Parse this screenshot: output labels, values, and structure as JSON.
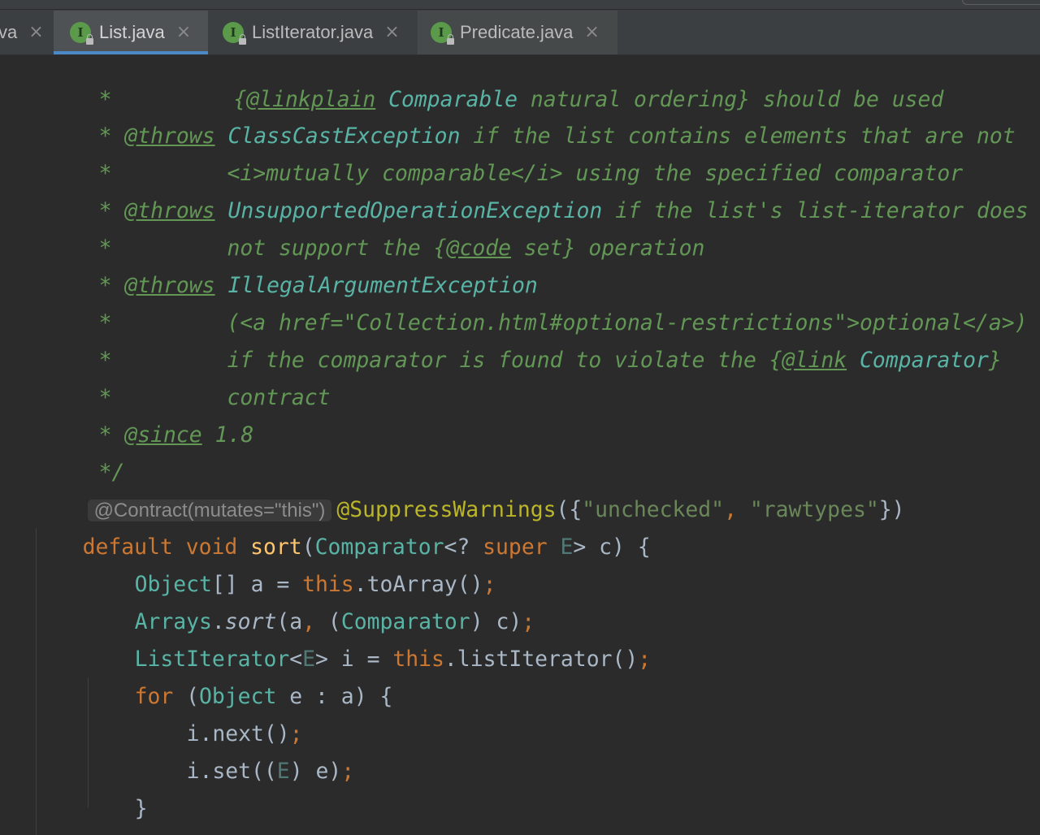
{
  "tabs": [
    {
      "label": "va",
      "active": false
    },
    {
      "label": "List.java",
      "active": true,
      "icon": "interface-icon"
    },
    {
      "label": "ListIterator.java",
      "active": false,
      "icon": "interface-icon"
    },
    {
      "label": "Predicate.java",
      "active": false,
      "icon": "interface-icon"
    }
  ],
  "tab_close_glyph": "×",
  "icon_letter": "I",
  "code": {
    "l1": {
      "star": "*",
      "open": "{",
      "tag": "@linkplain",
      "ref": "Comparable",
      "rest": " natural ordering} should be used"
    },
    "l2": {
      "star": "*",
      "tag": "@throws",
      "ref": "ClassCastException",
      "rest": " if the list contains elements that are not"
    },
    "l3": {
      "star": "*",
      "rest": "<i>mutually comparable</i> using the specified comparator"
    },
    "l4": {
      "star": "*",
      "tag": "@throws",
      "ref": "UnsupportedOperationException",
      "rest": " if the list's list-iterator does"
    },
    "l5": {
      "star": "*",
      "pre": "not support the {",
      "tag": "@code",
      "rest": " set} operation"
    },
    "l6": {
      "star": "*",
      "tag": "@throws",
      "ref": "IllegalArgumentException"
    },
    "l7": {
      "star": "*",
      "rest": "(<a href=\"Collection.html#optional-restrictions\">optional</a>)"
    },
    "l8": {
      "star": "*",
      "pre": "if the comparator is found to violate the {",
      "tag": "@link",
      "ref": "Comparator",
      "rest": "}"
    },
    "l9": {
      "star": "*",
      "rest": "contract"
    },
    "l10": {
      "star": "*",
      "tag": "@since",
      "rest": " 1.8"
    },
    "l11": {
      "end": "*/"
    },
    "l12": {
      "inlay": "@Contract(mutates=\"this\")",
      "ann": "@SuppressWarnings",
      "p1": "({",
      "s1": "\"unchecked\"",
      "comma": ", ",
      "s2": "\"rawtypes\"",
      "p2": "})"
    },
    "l13": {
      "kw1": "default",
      "kw2": "void",
      "fn": "sort",
      "p1": "(",
      "typ": "Comparator",
      "p2": "<? ",
      "kw3": "super",
      "gen": "E",
      "p3": "> c) {"
    },
    "l14": {
      "typ": "Object",
      "p1": "[] a = ",
      "kw": "this",
      "p2": ".toArray()",
      "semi": ";"
    },
    "l15": {
      "typ": "Arrays",
      "p1": ".",
      "sfn": "sort",
      "p2": "(a",
      "comma": ",",
      "p3": " (",
      "typ2": "Comparator",
      "p4": ") c)",
      "semi": ";"
    },
    "l16": {
      "typ": "ListIterator",
      "p1": "<",
      "gen": "E",
      "p2": "> i = ",
      "kw": "this",
      "p3": ".listIterator()",
      "semi": ";"
    },
    "l17": {
      "kw": "for",
      "p1": " (",
      "typ": "Object",
      "p2": " e : a) {"
    },
    "l18": {
      "p1": "i.next()",
      "semi": ";"
    },
    "l19": {
      "p1": "i.set((",
      "gen": "E",
      "p2": ") e)",
      "semi": ";"
    },
    "l20": {
      "p1": "}"
    },
    "l21": {
      "p1": "}"
    }
  }
}
